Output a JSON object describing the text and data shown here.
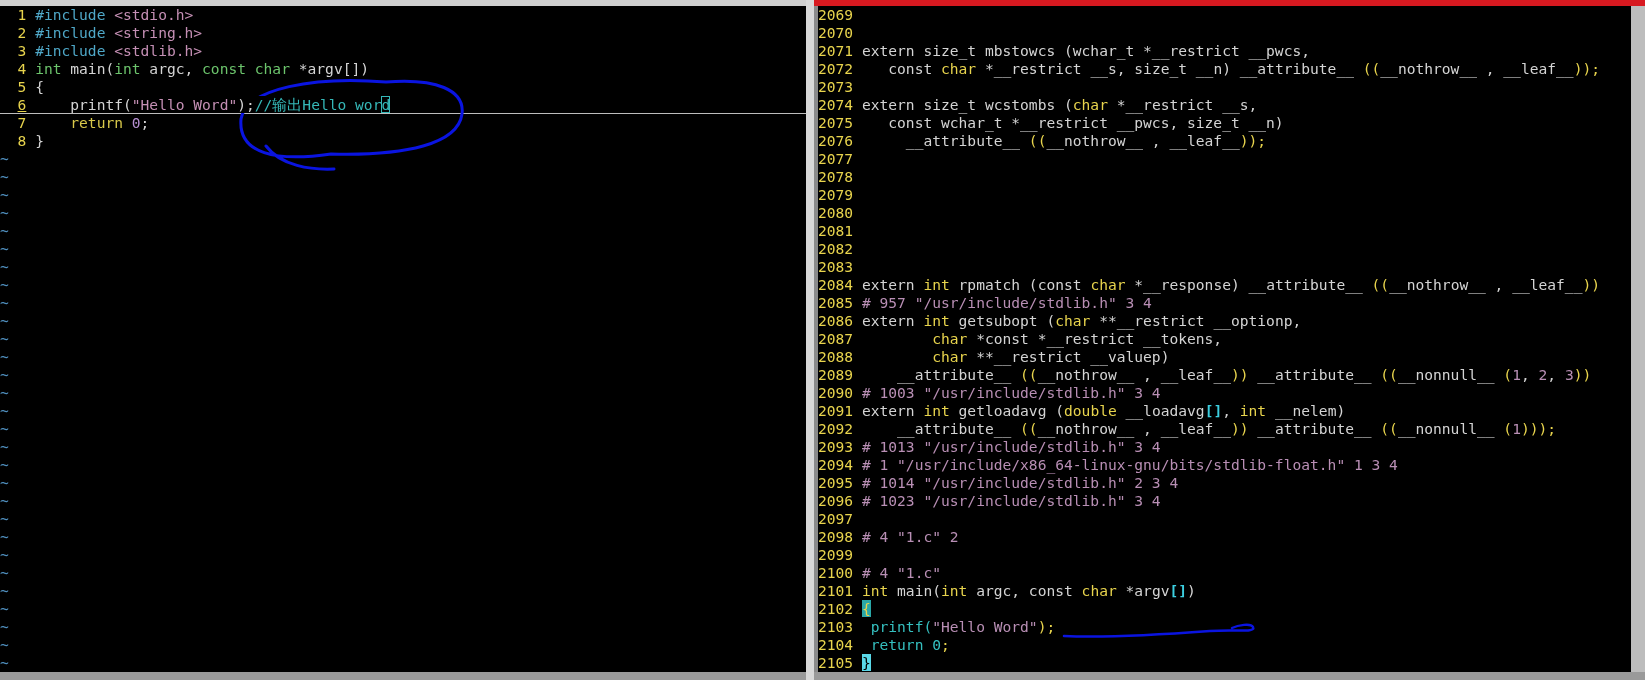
{
  "left_pane": {
    "lines": [
      {
        "number": "1",
        "cursor_line": false,
        "tokens": [
          {
            "kind": "preproc",
            "text": "#include"
          },
          {
            "kind": "include",
            "text": " <stdio.h>"
          }
        ]
      },
      {
        "number": "2",
        "cursor_line": false,
        "tokens": [
          {
            "kind": "preproc",
            "text": "#include"
          },
          {
            "kind": "include",
            "text": " <string.h>"
          }
        ]
      },
      {
        "number": "3",
        "cursor_line": false,
        "tokens": [
          {
            "kind": "preproc",
            "text": "#include"
          },
          {
            "kind": "include",
            "text": " <stdlib.h>"
          }
        ]
      },
      {
        "number": "4",
        "cursor_line": false,
        "tokens": [
          {
            "kind": "type",
            "text": "int"
          },
          {
            "kind": "plain",
            "text": " main("
          },
          {
            "kind": "type",
            "text": "int"
          },
          {
            "kind": "plain",
            "text": " argc, "
          },
          {
            "kind": "type",
            "text": "const char"
          },
          {
            "kind": "plain",
            "text": " *argv[])"
          }
        ]
      },
      {
        "number": "5",
        "cursor_line": false,
        "tokens": [
          {
            "kind": "plain",
            "text": "{"
          }
        ]
      },
      {
        "number": "6",
        "cursor_line": true,
        "tokens": [
          {
            "kind": "plain",
            "text": "    printf("
          },
          {
            "kind": "string",
            "text": "\"Hello Word\""
          },
          {
            "kind": "plain",
            "text": ");"
          },
          {
            "kind": "comment",
            "text": "//输出Hello wor"
          },
          {
            "kind": "cursor_inactive",
            "text": "d"
          }
        ]
      },
      {
        "number": "7",
        "cursor_line": false,
        "tokens": [
          {
            "kind": "statement",
            "text": "    return"
          },
          {
            "kind": "number",
            "text": " 0"
          },
          {
            "kind": "plain",
            "text": ";"
          }
        ]
      },
      {
        "number": "8",
        "cursor_line": false,
        "tokens": [
          {
            "kind": "plain",
            "text": "}"
          }
        ]
      }
    ],
    "filler": [
      "~",
      "~",
      "~",
      "~",
      "~",
      "~",
      "~",
      "~",
      "~",
      "~",
      "~",
      "~",
      "~",
      "~",
      "~",
      "~",
      "~",
      "~",
      "~",
      "~",
      "~",
      "~",
      "~",
      "~",
      "~",
      "~",
      "~",
      "~",
      "~"
    ]
  },
  "right_pane": {
    "lines": [
      {
        "number": "2069"
      },
      {
        "number": "2070"
      },
      {
        "number": "2071",
        "tokens": [
          {
            "kind": "plain",
            "text": "extern size_t mbstowcs (wchar_t *__restrict __pwcs,"
          }
        ]
      },
      {
        "number": "2072",
        "tokens": [
          {
            "kind": "plain",
            "text": "   const "
          },
          {
            "kind": "type",
            "text": "char"
          },
          {
            "kind": "plain",
            "text": " *__restrict __s, size_t __n) __attribute__ "
          },
          {
            "kind": "paren",
            "text": "(("
          },
          {
            "kind": "plain",
            "text": "__nothrow__ , __leaf__"
          },
          {
            "kind": "paren",
            "text": "));"
          }
        ]
      },
      {
        "number": "2073"
      },
      {
        "number": "2074",
        "tokens": [
          {
            "kind": "plain",
            "text": "extern size_t wcstombs ("
          },
          {
            "kind": "type",
            "text": "char"
          },
          {
            "kind": "plain",
            "text": " *__restrict __s,"
          }
        ]
      },
      {
        "number": "2075",
        "tokens": [
          {
            "kind": "plain",
            "text": "   const wchar_t *__restrict __pwcs, size_t __n)"
          }
        ]
      },
      {
        "number": "2076",
        "tokens": [
          {
            "kind": "plain",
            "text": "     __attribute__ "
          },
          {
            "kind": "paren",
            "text": "(("
          },
          {
            "kind": "plain",
            "text": "__nothrow__ , __leaf__"
          },
          {
            "kind": "paren",
            "text": "));"
          }
        ]
      },
      {
        "number": "2077"
      },
      {
        "number": "2078"
      },
      {
        "number": "2079"
      },
      {
        "number": "2080"
      },
      {
        "number": "2081"
      },
      {
        "number": "2082"
      },
      {
        "number": "2083"
      },
      {
        "number": "2084",
        "tokens": [
          {
            "kind": "plain",
            "text": "extern "
          },
          {
            "kind": "type",
            "text": "int"
          },
          {
            "kind": "plain",
            "text": " rpmatch (const "
          },
          {
            "kind": "type",
            "text": "char"
          },
          {
            "kind": "plain",
            "text": " *__response) __attribute__ "
          },
          {
            "kind": "paren",
            "text": "(("
          },
          {
            "kind": "plain",
            "text": "__nothrow__ , __leaf__"
          },
          {
            "kind": "paren",
            "text": "))"
          }
        ]
      },
      {
        "number": "2085",
        "tokens": [
          {
            "kind": "directive",
            "text": "# 957 \"/usr/include/stdlib.h\" 3 4"
          }
        ]
      },
      {
        "number": "2086",
        "tokens": [
          {
            "kind": "plain",
            "text": "extern "
          },
          {
            "kind": "type",
            "text": "int"
          },
          {
            "kind": "plain",
            "text": " getsubopt ("
          },
          {
            "kind": "type",
            "text": "char"
          },
          {
            "kind": "plain",
            "text": " **__restrict __optionp,"
          }
        ]
      },
      {
        "number": "2087",
        "tokens": [
          {
            "kind": "type",
            "text": "        char"
          },
          {
            "kind": "plain",
            "text": " *const *__restrict __tokens,"
          }
        ]
      },
      {
        "number": "2088",
        "tokens": [
          {
            "kind": "type",
            "text": "        char"
          },
          {
            "kind": "plain",
            "text": " **__restrict __valuep)"
          }
        ]
      },
      {
        "number": "2089",
        "tokens": [
          {
            "kind": "plain",
            "text": "    __attribute__ "
          },
          {
            "kind": "paren",
            "text": "(("
          },
          {
            "kind": "plain",
            "text": "__nothrow__ , __leaf__"
          },
          {
            "kind": "paren",
            "text": "))"
          },
          {
            "kind": "plain",
            "text": " __attribute__ "
          },
          {
            "kind": "paren",
            "text": "(("
          },
          {
            "kind": "plain",
            "text": "__nonnull__ "
          },
          {
            "kind": "paren",
            "text": "("
          },
          {
            "kind": "directive",
            "text": "1"
          },
          {
            "kind": "plain",
            "text": ", "
          },
          {
            "kind": "directive",
            "text": "2"
          },
          {
            "kind": "plain",
            "text": ", "
          },
          {
            "kind": "directive",
            "text": "3"
          },
          {
            "kind": "paren",
            "text": "))"
          }
        ]
      },
      {
        "number": "2090",
        "tokens": [
          {
            "kind": "directive",
            "text": "# 1003 \"/usr/include/stdlib.h\" 3 4"
          }
        ]
      },
      {
        "number": "2091",
        "tokens": [
          {
            "kind": "plain",
            "text": "extern "
          },
          {
            "kind": "type",
            "text": "int"
          },
          {
            "kind": "plain",
            "text": " getloadavg ("
          },
          {
            "kind": "type",
            "text": "double"
          },
          {
            "kind": "plain",
            "text": " __loadavg"
          },
          {
            "kind": "bracket",
            "text": "[]"
          },
          {
            "kind": "plain",
            "text": ", "
          },
          {
            "kind": "type",
            "text": "int"
          },
          {
            "kind": "plain",
            "text": " __nelem)"
          }
        ]
      },
      {
        "number": "2092",
        "tokens": [
          {
            "kind": "plain",
            "text": "    __attribute__ "
          },
          {
            "kind": "paren",
            "text": "(("
          },
          {
            "kind": "plain",
            "text": "__nothrow__ , __leaf__"
          },
          {
            "kind": "paren",
            "text": "))"
          },
          {
            "kind": "plain",
            "text": " __attribute__ "
          },
          {
            "kind": "paren",
            "text": "(("
          },
          {
            "kind": "plain",
            "text": "__nonnull__ "
          },
          {
            "kind": "paren",
            "text": "("
          },
          {
            "kind": "directive",
            "text": "1"
          },
          {
            "kind": "paren",
            "text": ")));"
          }
        ]
      },
      {
        "number": "2093",
        "tokens": [
          {
            "kind": "directive",
            "text": "# 1013 \"/usr/include/stdlib.h\" 3 4"
          }
        ]
      },
      {
        "number": "2094",
        "tokens": [
          {
            "kind": "directive",
            "text": "# 1 \"/usr/include/x86_64-linux-gnu/bits/stdlib-float.h\" 1 3 4"
          }
        ]
      },
      {
        "number": "2095",
        "tokens": [
          {
            "kind": "directive",
            "text": "# 1014 \"/usr/include/stdlib.h\" 2 3 4"
          }
        ]
      },
      {
        "number": "2096",
        "tokens": [
          {
            "kind": "directive",
            "text": "# 1023 \"/usr/include/stdlib.h\" 3 4"
          }
        ]
      },
      {
        "number": "2097"
      },
      {
        "number": "2098",
        "tokens": [
          {
            "kind": "directive",
            "text": "# 4 \"1.c\" 2"
          }
        ]
      },
      {
        "number": "2099"
      },
      {
        "number": "2100",
        "tokens": [
          {
            "kind": "directive",
            "text": "# 4 \"1.c\""
          }
        ]
      },
      {
        "number": "2101",
        "tokens": [
          {
            "kind": "type",
            "text": "int"
          },
          {
            "kind": "plain",
            "text": " main("
          },
          {
            "kind": "type",
            "text": "int"
          },
          {
            "kind": "plain",
            "text": " argc, const "
          },
          {
            "kind": "type",
            "text": "char"
          },
          {
            "kind": "plain",
            "text": " *argv"
          },
          {
            "kind": "bracket",
            "text": "[]"
          },
          {
            "kind": "plain",
            "text": ")"
          }
        ]
      },
      {
        "number": "2102",
        "tokens": [
          {
            "kind": "match",
            "text": "{"
          }
        ]
      },
      {
        "number": "2103",
        "tokens": [
          {
            "kind": "func",
            "text": " printf("
          },
          {
            "kind": "directive",
            "text": "\"Hello Word\""
          },
          {
            "kind": "paren",
            "text": ");"
          }
        ]
      },
      {
        "number": "2104",
        "tokens": [
          {
            "kind": "func",
            "text": " return 0"
          },
          {
            "kind": "paren",
            "text": ";"
          }
        ]
      },
      {
        "number": "2105",
        "tokens": [
          {
            "kind": "cursor",
            "text": "}"
          }
        ]
      }
    ]
  }
}
